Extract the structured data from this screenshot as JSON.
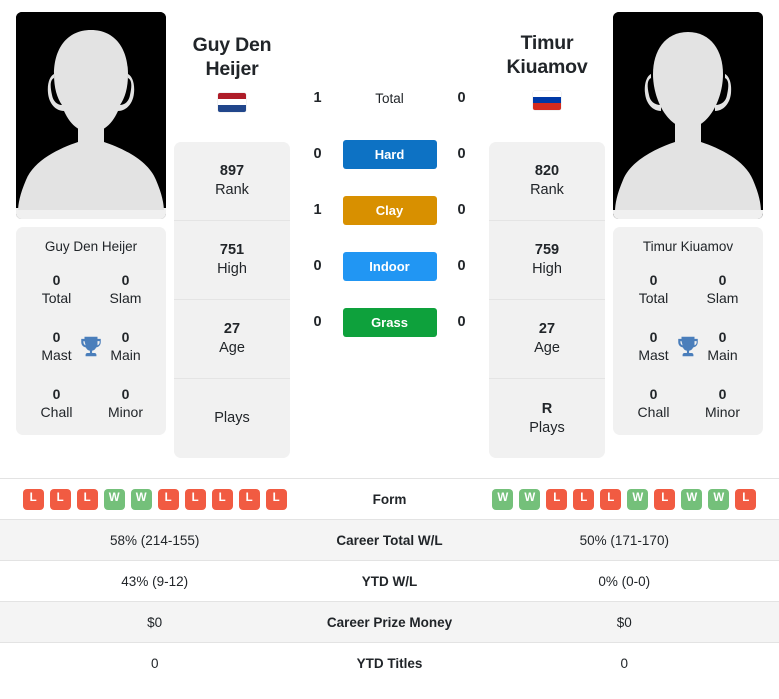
{
  "colors": {
    "hard": "#0d72c4",
    "clay": "#d89000",
    "indoor": "#2196f3",
    "grass": "#0ea13c",
    "win": "#74c07a",
    "loss": "#f15b42",
    "trophy": "#4a7ebb",
    "card_bg": "#f1f1f1",
    "row_alt": "#f4f4f4",
    "photo_bg": "#000000",
    "silhouette": "#e3e3e3"
  },
  "left_player": {
    "name": "Guy Den Heijer",
    "name_line1": "Guy Den",
    "name_line2": "Heijer",
    "photo_alt": "player-photo-placeholder",
    "flag": {
      "name": "netherlands-flag",
      "stripes": [
        "#ae1c28",
        "#ffffff",
        "#21468b"
      ]
    },
    "titles": [
      {
        "value": "0",
        "label": "Total"
      },
      {
        "value": "0",
        "label": "Slam"
      },
      {
        "value": "0",
        "label": "Mast"
      },
      {
        "value": "0",
        "label": "Main"
      },
      {
        "value": "0",
        "label": "Chall"
      },
      {
        "value": "0",
        "label": "Minor"
      }
    ],
    "ranks": [
      {
        "value": "897",
        "label": "Rank"
      },
      {
        "value": "751",
        "label": "High"
      },
      {
        "value": "27",
        "label": "Age"
      },
      {
        "value": "",
        "label": "Plays"
      }
    ],
    "form": [
      "L",
      "L",
      "L",
      "W",
      "W",
      "L",
      "L",
      "L",
      "L",
      "L"
    ],
    "career_total_wl": "58% (214-155)",
    "ytd_wl": "43% (9-12)",
    "career_prize_money": "$0",
    "ytd_titles": "0"
  },
  "right_player": {
    "name": "Timur Kiuamov",
    "name_line1": "Timur",
    "name_line2": "Kiuamov",
    "photo_alt": "player-photo-placeholder",
    "flag": {
      "name": "russia-flag",
      "stripes": [
        "#ffffff",
        "#0039a6",
        "#d52b1e"
      ]
    },
    "titles": [
      {
        "value": "0",
        "label": "Total"
      },
      {
        "value": "0",
        "label": "Slam"
      },
      {
        "value": "0",
        "label": "Mast"
      },
      {
        "value": "0",
        "label": "Main"
      },
      {
        "value": "0",
        "label": "Chall"
      },
      {
        "value": "0",
        "label": "Minor"
      }
    ],
    "ranks": [
      {
        "value": "820",
        "label": "Rank"
      },
      {
        "value": "759",
        "label": "High"
      },
      {
        "value": "27",
        "label": "Age"
      },
      {
        "value": "R",
        "label": "Plays"
      }
    ],
    "form": [
      "W",
      "W",
      "L",
      "L",
      "L",
      "W",
      "L",
      "W",
      "W",
      "L"
    ],
    "career_total_wl": "50% (171-170)",
    "ytd_wl": "0% (0-0)",
    "career_prize_money": "$0",
    "ytd_titles": "0"
  },
  "head_to_head": [
    {
      "label": "Total",
      "left": "1",
      "right": "0",
      "style": "plain",
      "color": ""
    },
    {
      "label": "Hard",
      "left": "0",
      "right": "0",
      "style": "pill",
      "color": "#0d72c4"
    },
    {
      "label": "Clay",
      "left": "1",
      "right": "0",
      "style": "pill",
      "color": "#d89000"
    },
    {
      "label": "Indoor",
      "left": "0",
      "right": "0",
      "style": "pill",
      "color": "#2196f3"
    },
    {
      "label": "Grass",
      "left": "0",
      "right": "0",
      "style": "pill",
      "color": "#0ea13c"
    }
  ],
  "table_rows": [
    {
      "key": "form",
      "label": "Form",
      "type": "form",
      "left": "",
      "right": ""
    },
    {
      "key": "career_total_wl",
      "label": "Career Total W/L",
      "type": "text",
      "left": "58% (214-155)",
      "right": "50% (171-170)"
    },
    {
      "key": "ytd_wl",
      "label": "YTD W/L",
      "type": "text",
      "left": "43% (9-12)",
      "right": "0% (0-0)"
    },
    {
      "key": "career_prize_money",
      "label": "Career Prize Money",
      "type": "text",
      "left": "$0",
      "right": "$0"
    },
    {
      "key": "ytd_titles",
      "label": "YTD Titles",
      "type": "text",
      "left": "0",
      "right": "0"
    }
  ]
}
